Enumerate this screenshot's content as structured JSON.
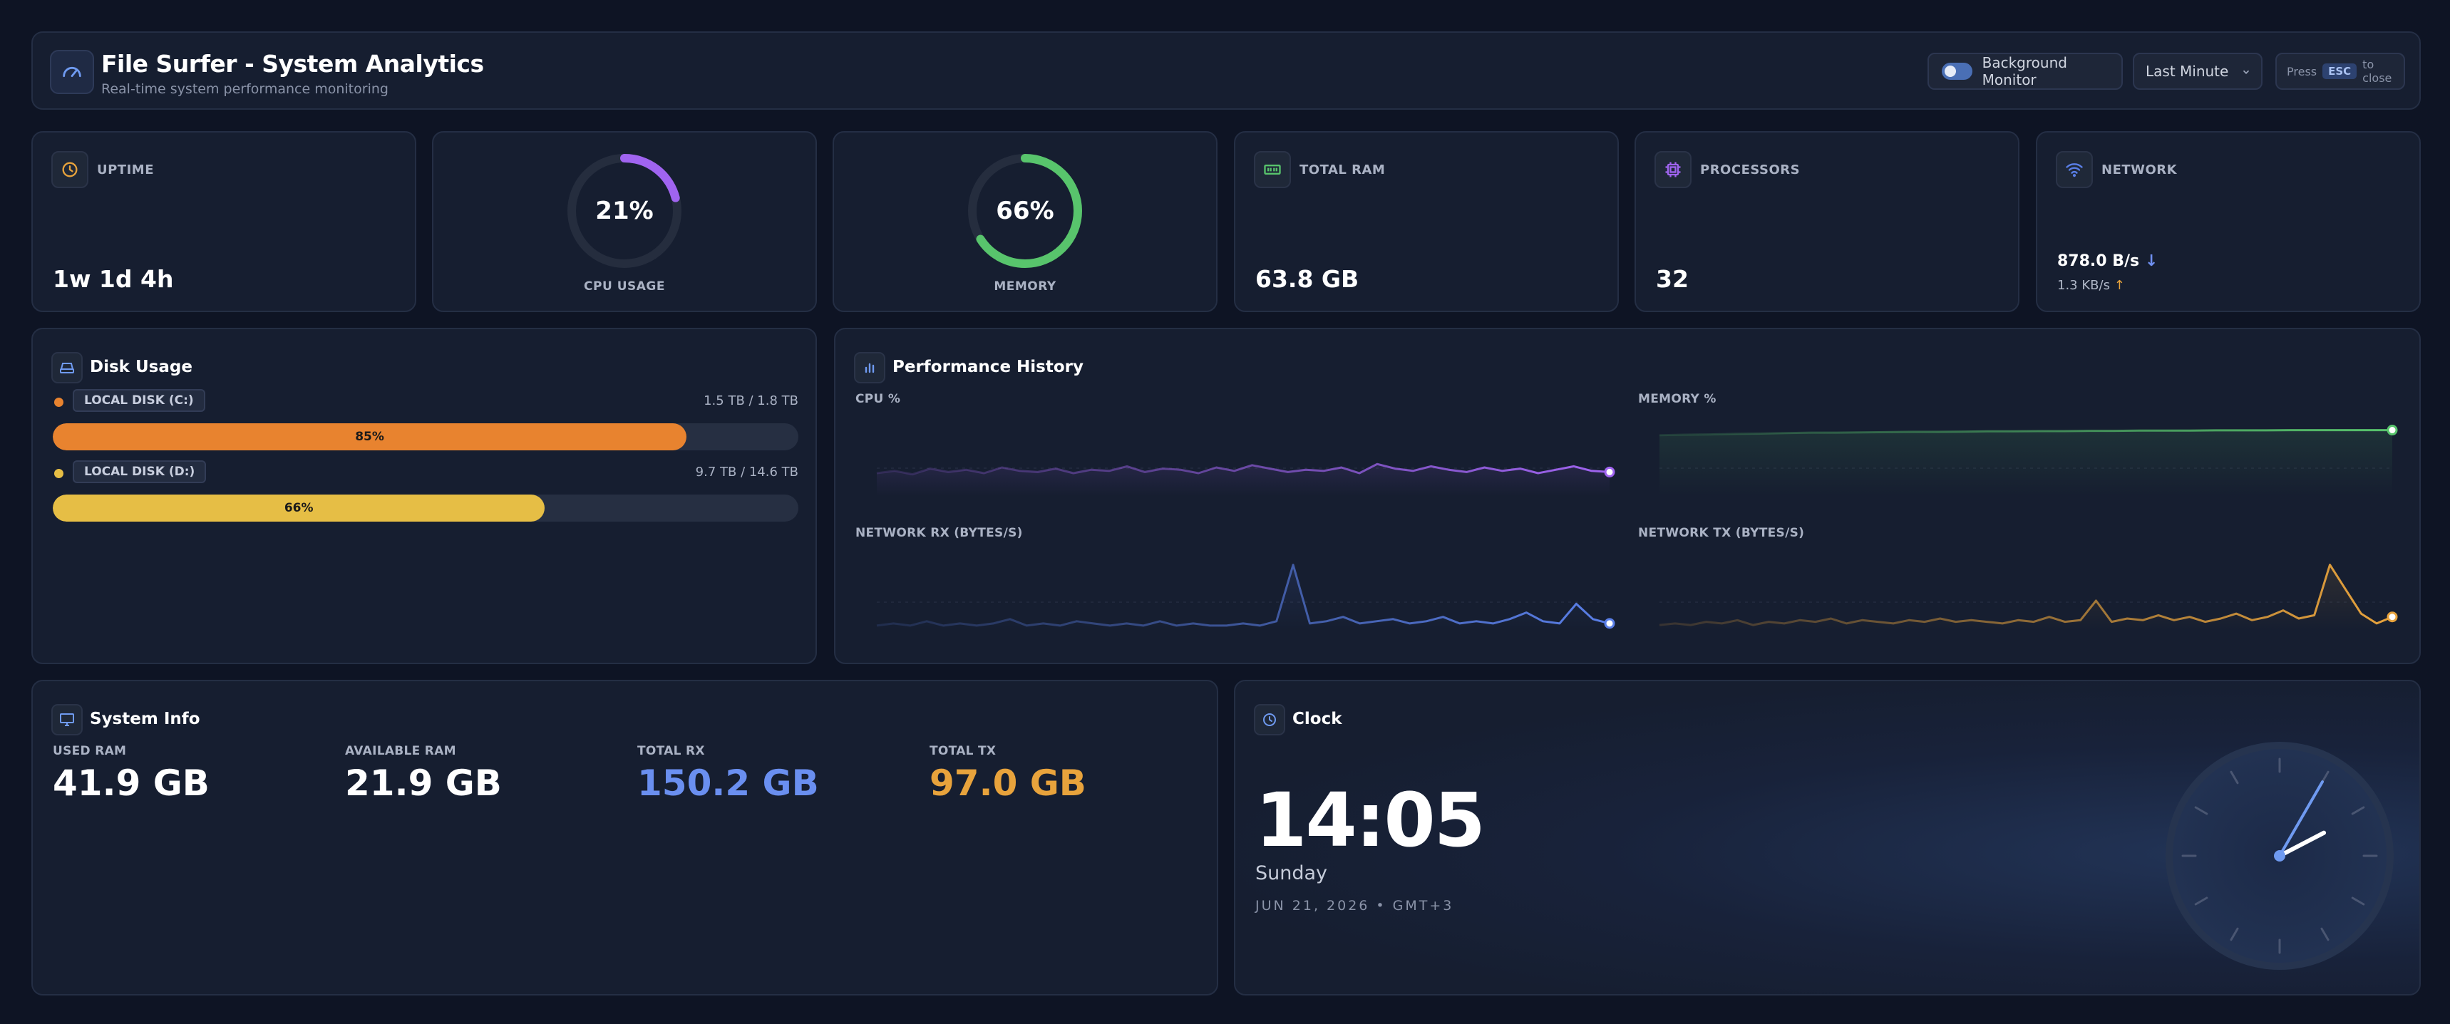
{
  "header": {
    "title": "File Surfer - System Analytics",
    "subtitle": "Real-time system performance monitoring",
    "background_monitor_label": "Background Monitor",
    "background_monitor_on": true,
    "range_select": "Last Minute",
    "esc_prefix": "Press",
    "esc_key": "ESC",
    "esc_suffix": "to close"
  },
  "stats": {
    "uptime": {
      "label": "UPTIME",
      "value": "1w 1d 4h"
    },
    "cpu": {
      "label": "CPU USAGE",
      "value": "21%",
      "fraction": 0.21
    },
    "memory": {
      "label": "MEMORY",
      "value": "66%",
      "fraction": 0.66
    },
    "total_ram": {
      "label": "TOTAL RAM",
      "value": "63.8 GB"
    },
    "processors": {
      "label": "PROCESSORS",
      "value": "32"
    },
    "network": {
      "label": "NETWORK",
      "down": "878.0 B/s",
      "up": "1.3 KB/s",
      "down_arrow": "↓",
      "up_arrow": "↑"
    }
  },
  "disk": {
    "title": "Disk Usage",
    "items": [
      {
        "name": "LOCAL DISK (C:)",
        "size": "1.5 TB / 1.8 TB",
        "percent_label": "85%",
        "percent": 85,
        "color": "#e8832f"
      },
      {
        "name": "LOCAL DISK (D:)",
        "size": "9.7 TB / 14.6 TB",
        "percent_label": "66%",
        "percent": 66,
        "color": "#e6be45"
      }
    ]
  },
  "perf": {
    "title": "Performance History",
    "cpu_label": "CPU %",
    "mem_label": "MEMORY %",
    "rx_label": "NETWORK RX (BYTES/S)",
    "tx_label": "NETWORK TX (BYTES/S)"
  },
  "chart_data": [
    {
      "type": "line",
      "title": "CPU %",
      "series": [
        {
          "values": [
            20,
            22,
            19,
            24,
            21,
            23,
            20,
            25,
            22,
            21,
            24,
            20,
            23,
            22,
            26,
            21,
            24,
            23,
            20,
            25,
            22,
            27,
            24,
            21,
            23,
            22,
            25,
            20,
            28,
            24,
            22,
            26,
            23,
            21,
            25,
            22,
            24,
            20,
            23,
            26,
            22,
            21
          ]
        }
      ],
      "color": "#a064f0"
    },
    {
      "type": "line",
      "title": "MEMORY %",
      "series": [
        {
          "values": [
            64,
            64.2,
            64.3,
            64.5,
            64.6,
            64.8,
            65,
            65,
            65.1,
            65.2,
            65.3,
            65.3,
            65.4,
            65.5,
            65.5,
            65.6,
            65.6,
            65.7,
            65.7,
            65.8,
            65.8,
            65.8,
            65.9,
            65.9,
            65.9,
            66,
            66,
            66,
            66,
            66
          ]
        }
      ],
      "color": "#58c46c"
    },
    {
      "type": "line",
      "title": "NETWORK RX (BYTES/S)",
      "series": [
        {
          "values": [
            2,
            3,
            2,
            4,
            2,
            3,
            2,
            3,
            5,
            2,
            3,
            2,
            4,
            3,
            2,
            3,
            2,
            4,
            2,
            3,
            2,
            2,
            3,
            2,
            4,
            30,
            3,
            4,
            6,
            3,
            4,
            5,
            3,
            4,
            6,
            3,
            4,
            3,
            5,
            8,
            4,
            3,
            12,
            5,
            3
          ]
        }
      ],
      "color": "#5a7fe8"
    },
    {
      "type": "line",
      "title": "NETWORK TX (BYTES/S)",
      "series": [
        {
          "values": [
            3,
            4,
            3,
            5,
            4,
            6,
            3,
            5,
            4,
            6,
            5,
            7,
            4,
            6,
            5,
            4,
            6,
            5,
            7,
            5,
            6,
            5,
            4,
            6,
            5,
            8,
            5,
            6,
            18,
            5,
            7,
            6,
            9,
            6,
            8,
            5,
            7,
            10,
            6,
            8,
            12,
            7,
            9,
            40,
            25,
            10,
            4,
            8
          ]
        }
      ],
      "color": "#e8a33c"
    }
  ],
  "sysinfo": {
    "title": "System Info",
    "items": [
      {
        "label": "USED RAM",
        "value": "41.9 GB",
        "color": "#ffffff"
      },
      {
        "label": "AVAILABLE RAM",
        "value": "21.9 GB",
        "color": "#ffffff"
      },
      {
        "label": "TOTAL RX",
        "value": "150.2 GB",
        "color": "#6a8ff0"
      },
      {
        "label": "TOTAL TX",
        "value": "97.0 GB",
        "color": "#e8a33c"
      }
    ]
  },
  "clock": {
    "title": "Clock",
    "time": "14:05",
    "day": "Sunday",
    "date": "JUN 21, 2026 • GMT+3",
    "hour": 14,
    "minute": 5
  }
}
